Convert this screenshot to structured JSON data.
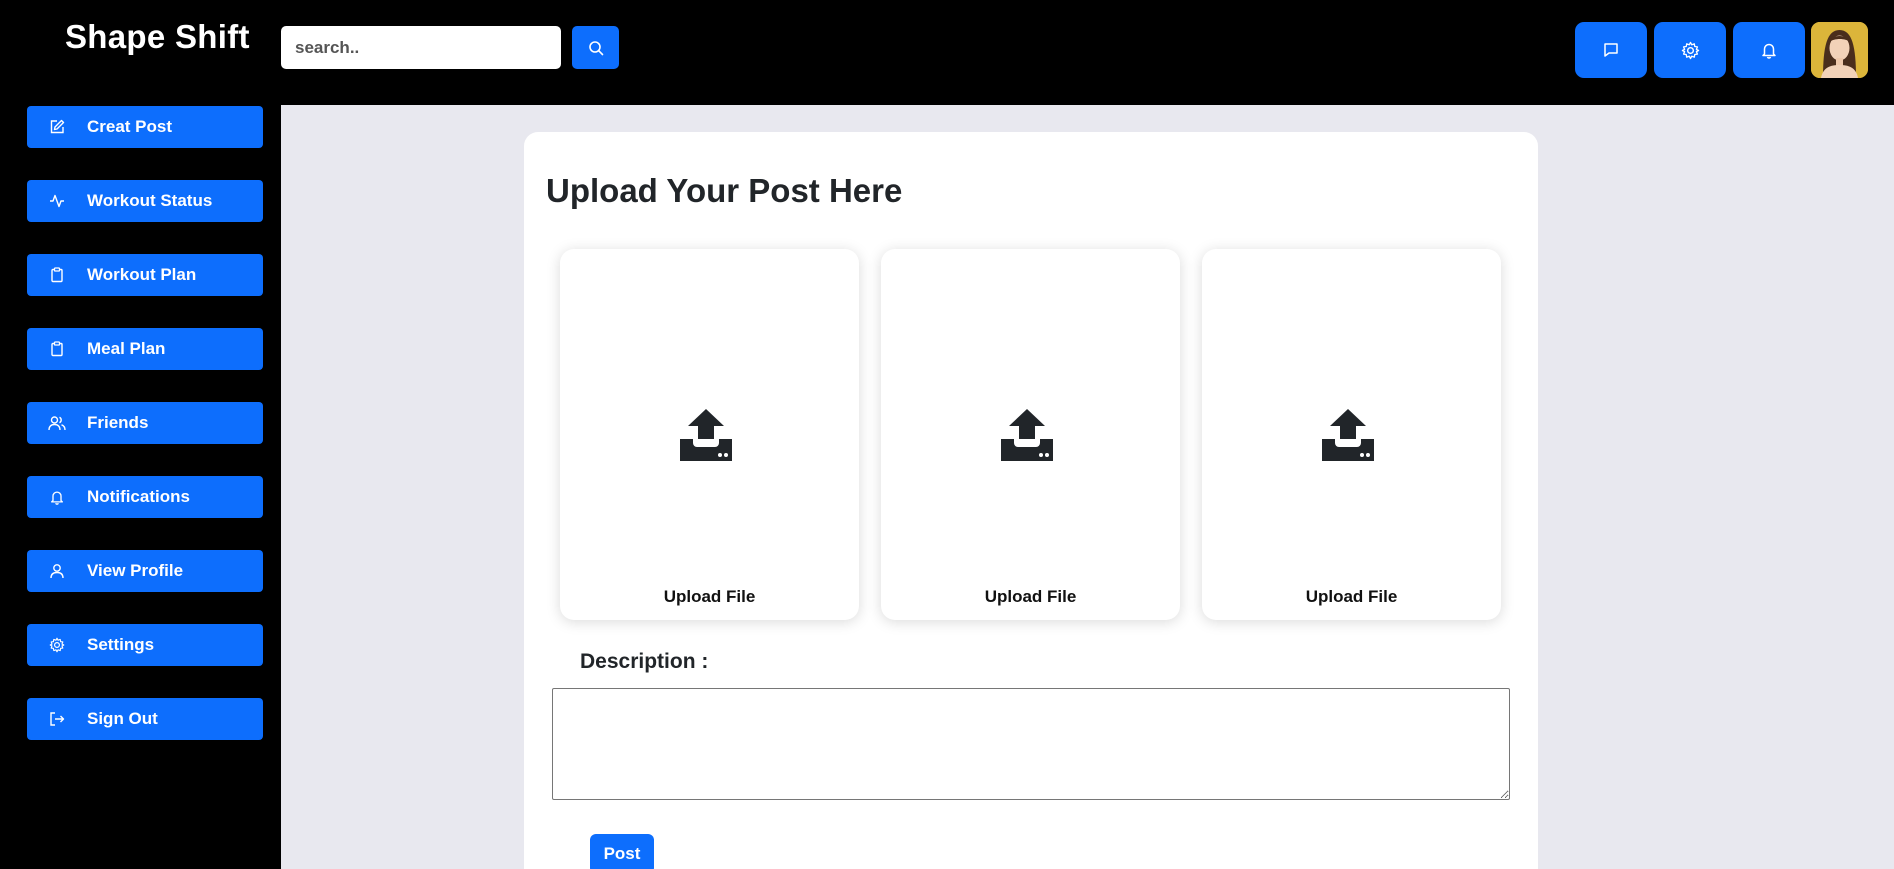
{
  "header": {
    "brand": "Shape Shift",
    "search_placeholder": "search..",
    "buttons": [
      {
        "icon": "message-icon"
      },
      {
        "icon": "gear-icon"
      },
      {
        "icon": "bell-icon"
      }
    ]
  },
  "sidebar": {
    "items": [
      {
        "label": "Creat Post",
        "icon": "edit-icon"
      },
      {
        "label": "Workout Status",
        "icon": "activity-icon"
      },
      {
        "label": "Workout Plan",
        "icon": "clipboard-icon"
      },
      {
        "label": "Meal Plan",
        "icon": "clipboard-icon"
      },
      {
        "label": "Friends",
        "icon": "users-icon"
      },
      {
        "label": "Notifications",
        "icon": "bell-icon"
      },
      {
        "label": "View Profile",
        "icon": "user-icon"
      },
      {
        "label": "Settings",
        "icon": "gear-icon"
      },
      {
        "label": "Sign Out",
        "icon": "sign-out-icon"
      }
    ]
  },
  "main": {
    "title": "Upload Your Post Here",
    "uploads": [
      {
        "label": "Upload File",
        "icon": "upload-icon"
      },
      {
        "label": "Upload File",
        "icon": "upload-icon"
      },
      {
        "label": "Upload File",
        "icon": "upload-icon"
      }
    ],
    "description_label": "Description :",
    "description_value": "",
    "post_label": "Post"
  },
  "colors": {
    "accent": "#0d6efd",
    "background": "#000000",
    "main_background": "#e8e8ef"
  }
}
